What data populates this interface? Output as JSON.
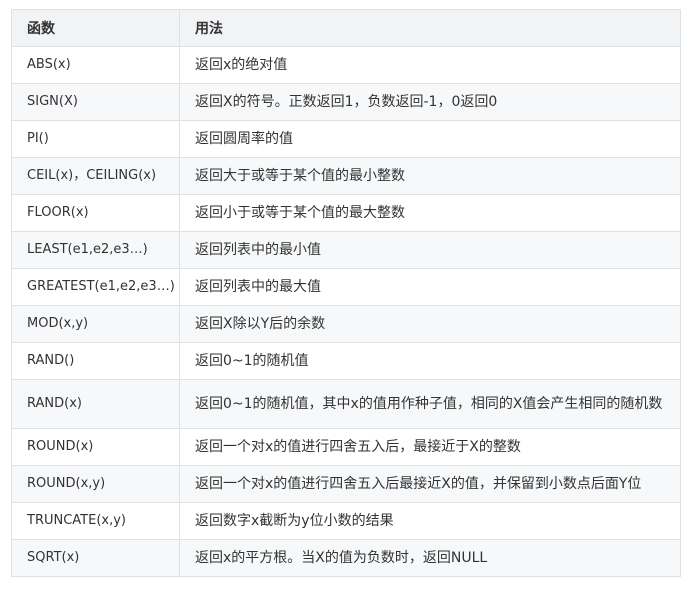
{
  "table": {
    "headers": [
      "函数",
      "用法"
    ],
    "rows": [
      {
        "func": "ABS(x)",
        "usage": "返回x的绝对值"
      },
      {
        "func": "SIGN(X)",
        "usage": "返回X的符号。正数返回1，负数返回-1，0返回0"
      },
      {
        "func": "PI()",
        "usage": "返回圆周率的值"
      },
      {
        "func": "CEIL(x)，CEILING(x)",
        "usage": "返回大于或等于某个值的最小整数"
      },
      {
        "func": "FLOOR(x)",
        "usage": "返回小于或等于某个值的最大整数"
      },
      {
        "func": "LEAST(e1,e2,e3…)",
        "usage": "返回列表中的最小值"
      },
      {
        "func": "GREATEST(e1,e2,e3…)",
        "usage": "返回列表中的最大值"
      },
      {
        "func": "MOD(x,y)",
        "usage": "返回X除以Y后的余数"
      },
      {
        "func": "RAND()",
        "usage": "返回0~1的随机值"
      },
      {
        "func": "RAND(x)",
        "usage": "返回0~1的随机值，其中x的值用作种子值，相同的X值会产生相同的随机数"
      },
      {
        "func": "ROUND(x)",
        "usage": "返回一个对x的值进行四舍五入后，最接近于X的整数"
      },
      {
        "func": "ROUND(x,y)",
        "usage": "返回一个对x的值进行四舍五入后最接近X的值，并保留到小数点后面Y位"
      },
      {
        "func": "TRUNCATE(x,y)",
        "usage": "返回数字x截断为y位小数的结果"
      },
      {
        "func": "SQRT(x)",
        "usage": "返回x的平方根。当X的值为负数时，返回NULL"
      }
    ]
  },
  "colors": {
    "header_bg": "#f2f3f5",
    "stripe_bg": "#f7f8fa",
    "border": "#dfe2e5",
    "text": "#333333"
  }
}
